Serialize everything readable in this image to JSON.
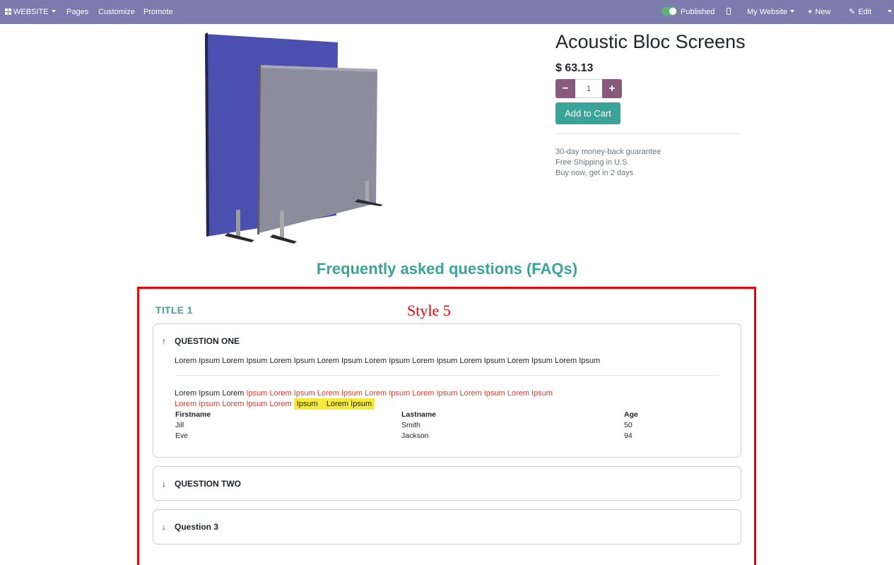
{
  "navbar": {
    "website": "WEBSITE",
    "pages": "Pages",
    "customize": "Customize",
    "promote": "Promote",
    "published": "Published",
    "my_website": "My Website",
    "new": "New",
    "edit": "Edit"
  },
  "product": {
    "name": "Acoustic Bloc Screens",
    "price": "$ 63.13",
    "quantity": "1",
    "add_to_cart": "Add to Cart",
    "guarantees": [
      "30-day money-back guarantee",
      "Free Shipping in U.S.",
      "Buy now, get in 2 days"
    ]
  },
  "faq": {
    "heading": "Frequently asked questions (FAQs)",
    "title": "TITLE 1",
    "style_label": "Style 5",
    "q1": {
      "question": "QUESTION ONE",
      "answer": "Lorem Ipsum Lorem Ipsum Lorem Ipsum Lorem Ipsum Lorem Ipsum Lorem Ipsum Lorem Ipsum Lorem Ipsum Lorem Ipsum",
      "line1_plain": "Lorem Ipsum Lorem ",
      "line1_red": "Ipsum Lorem Ipsum Lorem Ipsum Lorem Ipsum Lorem Ipsum Lorem Ipsum Lorem Ipsum",
      "line2_red": "Lorem Ipsum Lorem Ipsum Lorem ",
      "line2_highlight": "Ipsum    Lorem Ipsum",
      "table": {
        "headers": [
          "Firstname",
          "Lastname",
          "Age"
        ],
        "rows": [
          [
            "Jill",
            "Smith",
            "50"
          ],
          [
            "Eve",
            "Jackson",
            "94"
          ]
        ]
      }
    },
    "q2": {
      "question": "QUESTION TWO"
    },
    "q3": {
      "question": "Question 3"
    }
  },
  "colors": {
    "navbar": "#7c7bad",
    "accent": "#3aa39a",
    "qty_button": "#875a7b",
    "frame": "#ee0000"
  }
}
